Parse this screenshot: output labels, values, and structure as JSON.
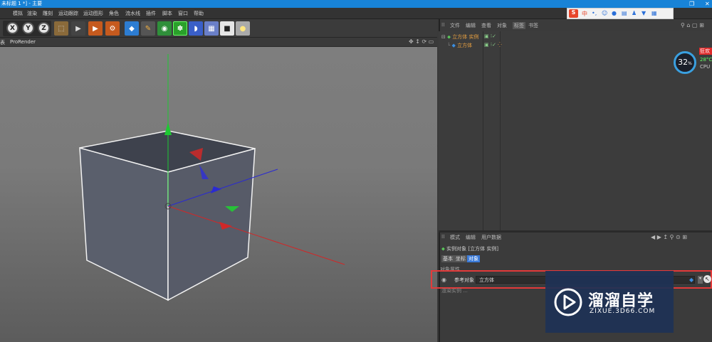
{
  "window": {
    "title": "未标题 1 *] - 主要",
    "restore_glyph": "❐",
    "close_glyph": "✕"
  },
  "menubar": {
    "items": [
      "模拟",
      "渲染",
      "雕刻",
      "运动跟踪",
      "运动图形",
      "角色",
      "流水线",
      "插件",
      "脚本",
      "窗口",
      "帮助"
    ]
  },
  "ime": {
    "logo": "S",
    "lang": "中",
    "punct": "•,",
    "icons": [
      "smile-icon",
      "mic-icon",
      "keyboard-icon",
      "user-icon",
      "shirt-icon",
      "grid-icon"
    ]
  },
  "toolbar": {
    "axis_x": "X",
    "axis_y": "Y",
    "axis_z": "Z"
  },
  "viewport": {
    "header_left": "表",
    "renderer": "ProRender"
  },
  "object_manager": {
    "menu": [
      "文件",
      "编辑",
      "查看",
      "对象",
      "标签",
      "书签"
    ],
    "rows": [
      {
        "label": "立方体 实例"
      },
      {
        "label": "立方体"
      }
    ]
  },
  "system_widget": {
    "cpu_percent": "32",
    "percent_sign": "%",
    "badge": "狂欢",
    "temp": "28°C",
    "cpu_label": "CPU"
  },
  "attribute_manager": {
    "menu": [
      "模式",
      "编辑",
      "用户数据"
    ],
    "object_title": "实例对象 [立方体 实例]",
    "tabs": [
      "基本",
      "坐标",
      "对象"
    ],
    "section": "对象属性",
    "ref_label": "参考对象",
    "ref_value": "立方体",
    "render_row": "渲染实例 ..."
  },
  "watermark": {
    "brand": "溜溜自学",
    "url": "ZIXUE.3D66.COM"
  },
  "colors": {
    "titlebar": "#1883d7",
    "accent_orange": "#e8a040",
    "highlight_red": "#e33a3a",
    "axis_green": "#1ec832",
    "axis_red": "#d02828",
    "axis_blue": "#2a2ad2"
  }
}
